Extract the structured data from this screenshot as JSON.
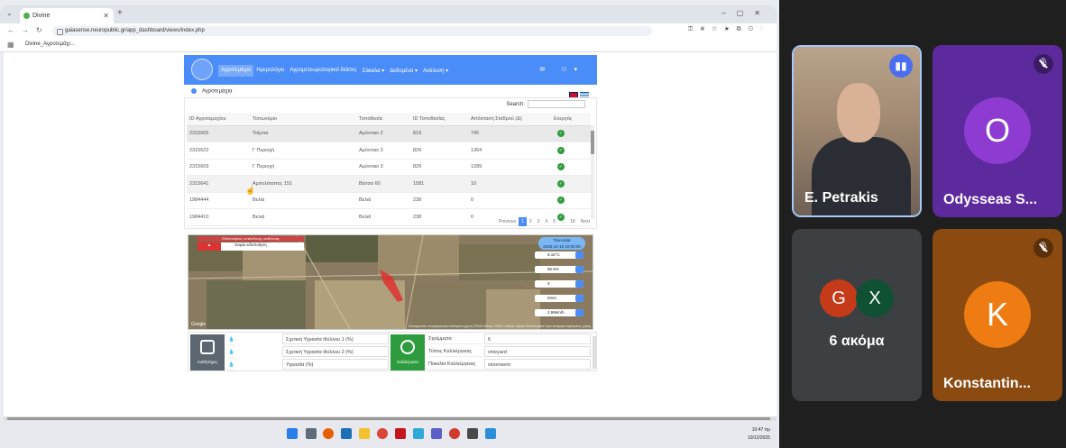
{
  "browser": {
    "tab_title": "Divine",
    "url": "gaiasense.neuropublic.gr/app_dashboard/views/index.php",
    "bookmark": "Divine_Αγροτεμάχι..."
  },
  "app": {
    "menu": [
      "Αγροτεμάχιο",
      "Ημερολόγιο",
      "Αγρομετεωρολογικοί δείκτες",
      "Σάκαλα ▾",
      "Δεδομένα ▾",
      "Ανάλυση ▾"
    ],
    "breadcrumb": "Αγροτεμάχια",
    "search_label": "Search:",
    "table": {
      "headers": [
        "ID Αγροτεμαχίου",
        "Τοπωνύμιο",
        "Τοποθεσία",
        "ID Τοποθεσίας",
        "Απόσταση Σταθμού (Δ)",
        "Ενεργός"
      ],
      "rows": [
        [
          "2315605",
          "Τσίμπα",
          "Αμύνταιο 2",
          "819",
          "745",
          "✓"
        ],
        [
          "2315622",
          "Γ Περιοχή",
          "Αμύνταιο 3",
          "829",
          "1364",
          "✓"
        ],
        [
          "2315609",
          "Γ Περιοχή",
          "Αμύνταιο 3",
          "829",
          "1289",
          "✓"
        ],
        [
          "2315641",
          "Αμπελότοπος 151",
          "Βέσσα 60",
          "1581",
          "10",
          "✓"
        ],
        [
          "1984444",
          "Βελιά",
          "Βελιά",
          "238",
          "0",
          "✓"
        ],
        [
          "1984410",
          "Βελιά",
          "Βελιά",
          "238",
          "0",
          "✓"
        ]
      ]
    },
    "pager": [
      "Previous",
      "1",
      "2",
      "3",
      "4",
      "5",
      "...",
      "18",
      "Next"
    ],
    "map": {
      "alarm_title": "Ειδοποιήσεις επικίνδυνης ασθένειας",
      "alarm_value": "Καμία ειδοποίηση",
      "weather_header": "Τελευταία\n2025-12-10 10:00:00",
      "weather": [
        "5.15°C",
        "86.5%",
        "0",
        "0mm",
        "2.99km/h"
      ],
      "google": "Google",
      "attribution": "Συντομεύσεις πληκτρολογίου  Δεδομένα χάρτη ©2025 Airbus, CNES / Airbus, Maxar Technologies  Όροι  Αναφορά σφάλματος χάρτη"
    },
    "sensors": {
      "label": "Αισθητήρες",
      "rows": [
        "Σχετική Υγρασία Φύλλου 1 (%)",
        "Σχετική Υγρασία Φύλλου 2 (%)",
        "Υγρασία (%)"
      ]
    },
    "crop": {
      "label": "Καλλιέργεια",
      "rows": [
        [
          "Στρέμματα",
          "6"
        ],
        [
          "Τύπος Καλλιέργειας",
          "vineyard"
        ],
        [
          "Ποικιλία Καλλιέργειας",
          "xinomavro"
        ]
      ]
    }
  },
  "taskbar": {
    "time": "10:47 πμ",
    "date": "10/12/2025"
  },
  "participants": [
    {
      "name": "E. Petrakis",
      "speaking": true
    },
    {
      "name": "Odysseas S...",
      "initial": "O",
      "color": "#8e3bd1",
      "muted": true
    },
    {
      "name": "Konstantin...",
      "initial": "K",
      "color": "#ef7c12",
      "muted": true
    }
  ],
  "more": {
    "label": "6 ακόμα",
    "avatars": [
      {
        "initial": "G",
        "color": "#c53b1a"
      },
      {
        "initial": "X",
        "color": "#0f5132"
      }
    ]
  }
}
